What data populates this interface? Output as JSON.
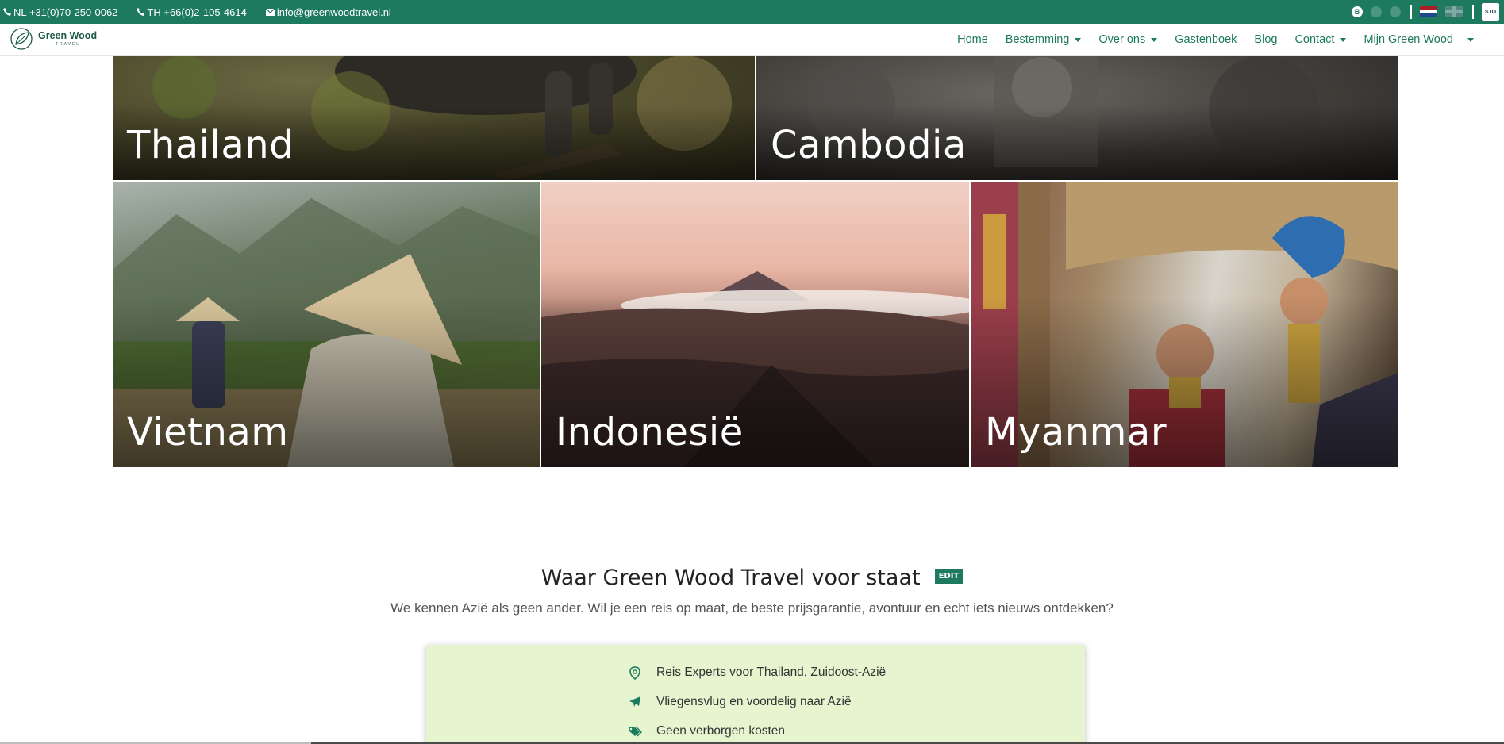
{
  "topbar": {
    "phone_nl": "NL +31(0)70-250-0062",
    "phone_th": "TH +66(0)2-105-4614",
    "email": "info@greenwoodtravel.nl",
    "social_b": "B",
    "sto_badge": "STO"
  },
  "logo": {
    "name": "Green Wood",
    "sub": "TRAVEL"
  },
  "nav": {
    "items": [
      {
        "label": "Home"
      },
      {
        "label": "Bestemming"
      },
      {
        "label": "Over ons"
      },
      {
        "label": "Gastenboek"
      },
      {
        "label": "Blog"
      },
      {
        "label": "Contact"
      },
      {
        "label": "Mijn Green Wood"
      }
    ]
  },
  "destinations": [
    {
      "name": "Thailand"
    },
    {
      "name": "Cambodia"
    },
    {
      "name": "Vietnam"
    },
    {
      "name": "Indonesië"
    },
    {
      "name": "Myanmar"
    }
  ],
  "about": {
    "title": "Waar Green Wood Travel voor staat",
    "edit_label": "EDIT",
    "subtitle": "We kennen Azië als geen ander. Wil je een reis op maat, de beste prijsgarantie, avontuur en echt iets nieuws ontdekken?"
  },
  "usp": [
    {
      "icon": "map-pin-icon",
      "text": "Reis Experts voor Thailand, Zuidoost-Azië"
    },
    {
      "icon": "airplane-icon",
      "text": "Vliegensvlug en voordelig naar Azië"
    },
    {
      "icon": "tags-icon",
      "text": "Geen verborgen kosten"
    }
  ],
  "colors": {
    "brand": "#1d7a5f",
    "usp_bg": "#e6f5d0"
  }
}
